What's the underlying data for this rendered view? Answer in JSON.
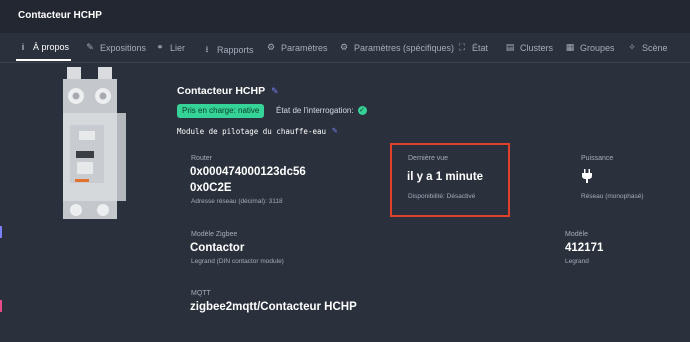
{
  "window": {
    "title": "Contacteur HCHP"
  },
  "tabs": [
    {
      "label": "À propos",
      "icon": "info-icon"
    },
    {
      "label": "Expositions",
      "icon": "pencil-icon"
    },
    {
      "label": "Lier",
      "icon": "link-icon"
    },
    {
      "label": "Rapports",
      "icon": "download-icon"
    },
    {
      "label": "Paramètres",
      "icon": "cogs-icon"
    },
    {
      "label": "Paramètres (spécifiques)",
      "icon": "cog-icon"
    },
    {
      "label": "État",
      "icon": "expand-icon"
    },
    {
      "label": "Clusters",
      "icon": "server-icon"
    },
    {
      "label": "Groupes",
      "icon": "group-icon"
    },
    {
      "label": "Scène",
      "icon": "magic-icon"
    }
  ],
  "device": {
    "name": "Contacteur HCHP",
    "support_badge": "Pris en charge: native",
    "interrogation_label": "État de l'interrogation:",
    "description": "Module de pilotage du chauffe-eau"
  },
  "stats": {
    "router": {
      "label": "Router",
      "value_line1": "0x000474000123dc56",
      "value_line2": "0x0C2E",
      "sub": "Adresse réseau (décimal): 3118"
    },
    "last_seen": {
      "label": "Dernière vue",
      "value": "il y a 1 minute",
      "sub": "Disponibilité: Désactivé"
    },
    "power": {
      "label": "Puissance",
      "icon": "plug-icon",
      "sub": "Réseau (monophasé)"
    },
    "zigbee_model": {
      "label": "Modèle Zigbee",
      "value": "Contactor",
      "sub": "Legrand (DIN contactor module)"
    },
    "model": {
      "label": "Modèle",
      "value": "412171",
      "sub": "Legrand"
    },
    "mqtt": {
      "label": "MQTT",
      "value": "zigbee2mqtt/Contacteur HCHP"
    }
  },
  "colors": {
    "accent_badge": "#36d399",
    "highlight_box": "#e2402a",
    "edit_icon": "#7b7ff8",
    "background": "#2a303c"
  }
}
